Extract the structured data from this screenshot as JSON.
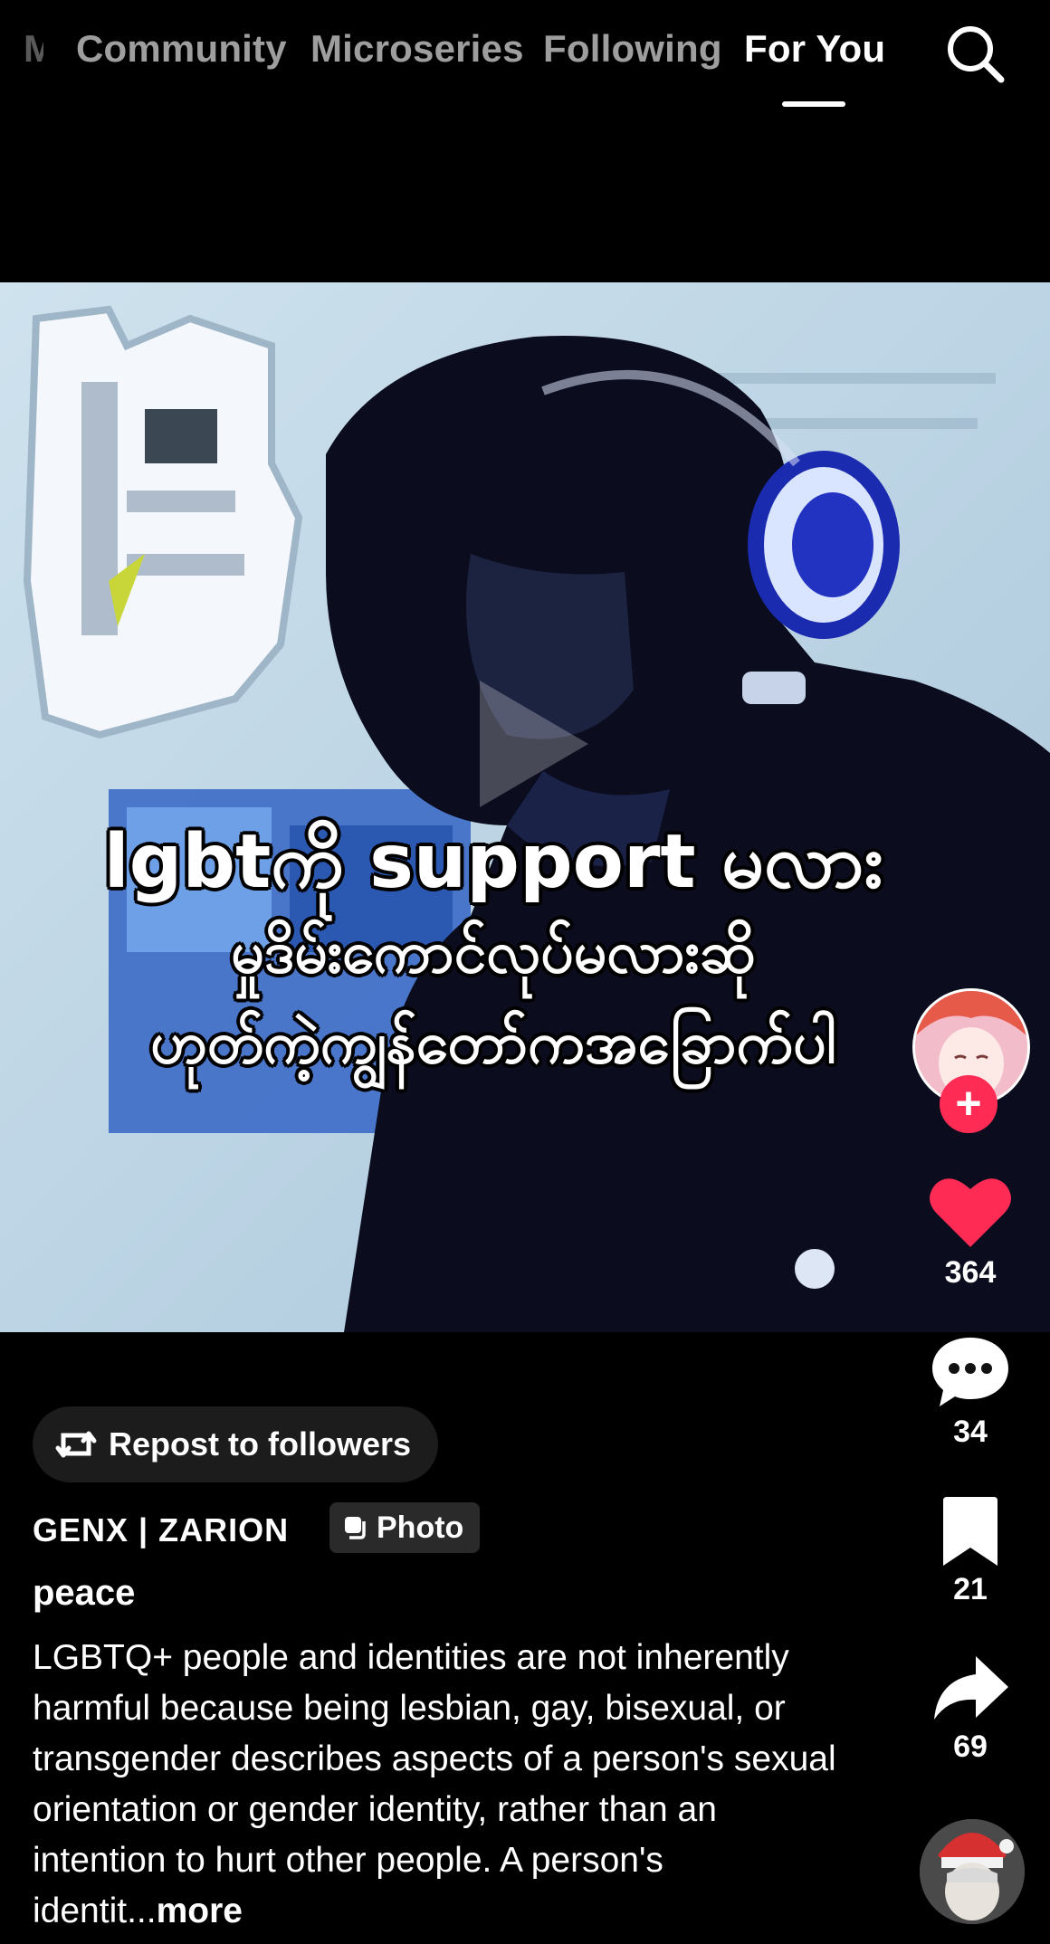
{
  "nav": {
    "partial_tab": "M",
    "tabs": [
      "Community",
      "Microseries",
      "Following",
      "For You"
    ],
    "active_tab": "For You",
    "search_icon": "search-icon"
  },
  "media": {
    "overlay_lines": [
      "lgbtကို support မလား",
      "မှုဒိမ်းကောင်လုပ်မလားဆို",
      "ဟုတ်ကဲ့ကျွန်တော်ကအခြောက်ပါ"
    ]
  },
  "rail": {
    "likes": "364",
    "comments": "34",
    "saves": "21",
    "shares": "69",
    "like_color": "#fe2c55",
    "follow_plus": "+"
  },
  "info": {
    "repost_label": "Repost to followers",
    "username": "GENX | ZARION",
    "badge": "Photo",
    "title": "peace",
    "caption": "LGBTQ+ people and identities are not inherently harmful because being lesbian, gay, bisexual, or transgender describes aspects of a person's sexual orientation or gender identity, rather than an intention to hurt other people. A person's identit...",
    "more_label": "more"
  }
}
